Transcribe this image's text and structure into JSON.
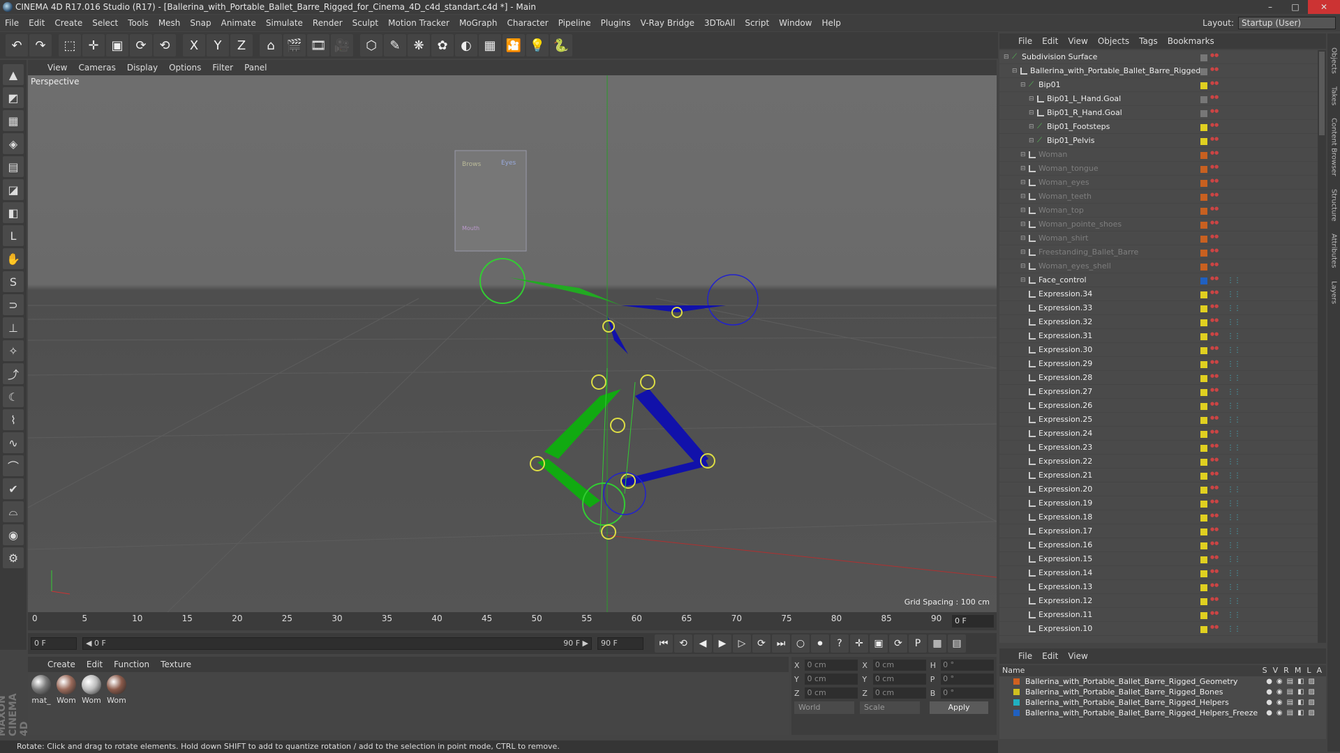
{
  "window": {
    "title": "CINEMA 4D R17.016 Studio (R17) - [Ballerina_with_Portable_Ballet_Barre_Rigged_for_Cinema_4D_c4d_standart.c4d *] - Main",
    "minimize": "–",
    "maximize": "□",
    "close": "✕"
  },
  "menu": [
    "File",
    "Edit",
    "Create",
    "Select",
    "Tools",
    "Mesh",
    "Snap",
    "Animate",
    "Simulate",
    "Render",
    "Sculpt",
    "Motion Tracker",
    "MoGraph",
    "Character",
    "Pipeline",
    "Plugins",
    "V-Ray Bridge",
    "3DToAll",
    "Script",
    "Window",
    "Help"
  ],
  "layout": {
    "label": "Layout:",
    "value": "Startup (User)"
  },
  "toolbar": {
    "icons": [
      "↶",
      "↷",
      "⬚",
      "✛",
      "▣",
      "⟳",
      "⟲",
      "X",
      "Y",
      "Z",
      "⌂",
      "🎬",
      "🎞",
      "🎥",
      "⬡",
      "✎",
      "❋",
      "✿",
      "◐",
      "▦",
      "🎦",
      "💡",
      "🐍"
    ]
  },
  "left_tools": [
    "▲",
    "◩",
    "▦",
    "◈",
    "▤",
    "◪",
    "◧",
    "L",
    "✋",
    "S",
    "⊃",
    "⊥",
    "✧",
    "⤴",
    "☾",
    "⌇",
    "∿",
    "⌒",
    "✔",
    "⌓",
    "◉",
    "⚙"
  ],
  "viewport": {
    "menu": [
      "View",
      "Cameras",
      "Display",
      "Options",
      "Filter",
      "Panel"
    ],
    "label": "Perspective",
    "grid_spacing": "Grid Spacing : 100 cm",
    "panel_labels": [
      "Brows",
      "Eyes",
      "Mouth"
    ]
  },
  "timeline": {
    "ticks": [
      "0",
      "5",
      "10",
      "15",
      "20",
      "25",
      "30",
      "35",
      "40",
      "45",
      "50",
      "55",
      "60",
      "65",
      "70",
      "75",
      "80",
      "85",
      "90"
    ],
    "current_frame": "0 F"
  },
  "transport": {
    "start_frame": "0 F",
    "range_start": "◀ 0 F",
    "range_end": "90 F ▶",
    "end_frame": "90 F",
    "buttons": [
      "⏮",
      "⟲",
      "◀",
      "▶",
      "▷",
      "⟳",
      "⏭",
      "○",
      "⏺",
      "?",
      "✛",
      "▣",
      "⟳",
      "P",
      "▦",
      "▤"
    ]
  },
  "material_manager": {
    "menu": [
      "Create",
      "Edit",
      "Function",
      "Texture"
    ],
    "materials": [
      {
        "name": "mat_",
        "color": "#7a7a7a"
      },
      {
        "name": "Wom",
        "color": "#9a6a5a"
      },
      {
        "name": "Wom",
        "color": "#bbbbbb"
      },
      {
        "name": "Wom",
        "color": "#8a5a4a"
      }
    ]
  },
  "coordinates": {
    "rows": [
      {
        "a": "X",
        "av": "0 cm",
        "b": "X",
        "bv": "0 cm",
        "c": "H",
        "cv": "0 °"
      },
      {
        "a": "Y",
        "av": "0 cm",
        "b": "Y",
        "bv": "0 cm",
        "c": "P",
        "cv": "0 °"
      },
      {
        "a": "Z",
        "av": "0 cm",
        "b": "Z",
        "bv": "0 cm",
        "c": "B",
        "cv": "0 °"
      }
    ],
    "mode": "World",
    "scale": "Scale",
    "apply": "Apply"
  },
  "status": "Rotate: Click and drag to rotate elements. Hold down SHIFT to add to quantize rotation / add to the selection in point mode, CTRL to remove.",
  "brand": "MAXON CINEMA 4D",
  "object_manager": {
    "menu": [
      "File",
      "Edit",
      "View",
      "Objects",
      "Tags",
      "Bookmarks"
    ],
    "objects": [
      {
        "name": "Subdivision Surface",
        "indent": 0,
        "icon": "bone",
        "dim": false,
        "tag": "#777777"
      },
      {
        "name": "Ballerina_with_Portable_Ballet_Barre_Rigged",
        "indent": 1,
        "icon": "null",
        "dim": false,
        "tag": "#777777"
      },
      {
        "name": "Bip01",
        "indent": 2,
        "icon": "bone",
        "dim": false,
        "tag": "#e0d020"
      },
      {
        "name": "Bip01_L_Hand.Goal",
        "indent": 3,
        "icon": "null",
        "dim": false,
        "tag": "#777777"
      },
      {
        "name": "Bip01_R_Hand.Goal",
        "indent": 3,
        "icon": "null",
        "dim": false,
        "tag": "#777777"
      },
      {
        "name": "Bip01_Footsteps",
        "indent": 3,
        "icon": "bone",
        "dim": false,
        "tag": "#e0d020"
      },
      {
        "name": "Bip01_Pelvis",
        "indent": 3,
        "icon": "bone",
        "dim": false,
        "tag": "#e0d020"
      },
      {
        "name": "Woman",
        "indent": 2,
        "icon": "null",
        "dim": true,
        "tag": "#c86020"
      },
      {
        "name": "Woman_tongue",
        "indent": 2,
        "icon": "null",
        "dim": true,
        "tag": "#c86020"
      },
      {
        "name": "Woman_eyes",
        "indent": 2,
        "icon": "null",
        "dim": true,
        "tag": "#c86020"
      },
      {
        "name": "Woman_teeth",
        "indent": 2,
        "icon": "null",
        "dim": true,
        "tag": "#c86020"
      },
      {
        "name": "Woman_top",
        "indent": 2,
        "icon": "null",
        "dim": true,
        "tag": "#c86020"
      },
      {
        "name": "Woman_pointe_shoes",
        "indent": 2,
        "icon": "null",
        "dim": true,
        "tag": "#c86020"
      },
      {
        "name": "Woman_shirt",
        "indent": 2,
        "icon": "null",
        "dim": true,
        "tag": "#c86020"
      },
      {
        "name": "Freestanding_Ballet_Barre",
        "indent": 2,
        "icon": "null",
        "dim": true,
        "tag": "#c86020"
      },
      {
        "name": "Woman_eyes_shell",
        "indent": 2,
        "icon": "null",
        "dim": true,
        "tag": "#c86020"
      },
      {
        "name": "Face_control",
        "indent": 2,
        "icon": "null",
        "dim": false,
        "tag": "#2060c0"
      },
      {
        "name": "Expression.34",
        "indent": 2,
        "icon": "null",
        "dim": false,
        "tag": "#e0d020"
      },
      {
        "name": "Expression.33",
        "indent": 2,
        "icon": "null",
        "dim": false,
        "tag": "#e0d020"
      },
      {
        "name": "Expression.32",
        "indent": 2,
        "icon": "null",
        "dim": false,
        "tag": "#e0d020"
      },
      {
        "name": "Expression.31",
        "indent": 2,
        "icon": "null",
        "dim": false,
        "tag": "#e0d020"
      },
      {
        "name": "Expression.30",
        "indent": 2,
        "icon": "null",
        "dim": false,
        "tag": "#e0d020"
      },
      {
        "name": "Expression.29",
        "indent": 2,
        "icon": "null",
        "dim": false,
        "tag": "#e0d020"
      },
      {
        "name": "Expression.28",
        "indent": 2,
        "icon": "null",
        "dim": false,
        "tag": "#e0d020"
      },
      {
        "name": "Expression.27",
        "indent": 2,
        "icon": "null",
        "dim": false,
        "tag": "#e0d020"
      },
      {
        "name": "Expression.26",
        "indent": 2,
        "icon": "null",
        "dim": false,
        "tag": "#e0d020"
      },
      {
        "name": "Expression.25",
        "indent": 2,
        "icon": "null",
        "dim": false,
        "tag": "#e0d020"
      },
      {
        "name": "Expression.24",
        "indent": 2,
        "icon": "null",
        "dim": false,
        "tag": "#e0d020"
      },
      {
        "name": "Expression.23",
        "indent": 2,
        "icon": "null",
        "dim": false,
        "tag": "#e0d020"
      },
      {
        "name": "Expression.22",
        "indent": 2,
        "icon": "null",
        "dim": false,
        "tag": "#e0d020"
      },
      {
        "name": "Expression.21",
        "indent": 2,
        "icon": "null",
        "dim": false,
        "tag": "#e0d020"
      },
      {
        "name": "Expression.20",
        "indent": 2,
        "icon": "null",
        "dim": false,
        "tag": "#e0d020"
      },
      {
        "name": "Expression.19",
        "indent": 2,
        "icon": "null",
        "dim": false,
        "tag": "#e0d020"
      },
      {
        "name": "Expression.18",
        "indent": 2,
        "icon": "null",
        "dim": false,
        "tag": "#e0d020"
      },
      {
        "name": "Expression.17",
        "indent": 2,
        "icon": "null",
        "dim": false,
        "tag": "#e0d020"
      },
      {
        "name": "Expression.16",
        "indent": 2,
        "icon": "null",
        "dim": false,
        "tag": "#e0d020"
      },
      {
        "name": "Expression.15",
        "indent": 2,
        "icon": "null",
        "dim": false,
        "tag": "#e0d020"
      },
      {
        "name": "Expression.14",
        "indent": 2,
        "icon": "null",
        "dim": false,
        "tag": "#e0d020"
      },
      {
        "name": "Expression.13",
        "indent": 2,
        "icon": "null",
        "dim": false,
        "tag": "#e0d020"
      },
      {
        "name": "Expression.12",
        "indent": 2,
        "icon": "null",
        "dim": false,
        "tag": "#e0d020"
      },
      {
        "name": "Expression.11",
        "indent": 2,
        "icon": "null",
        "dim": false,
        "tag": "#e0d020"
      },
      {
        "name": "Expression.10",
        "indent": 2,
        "icon": "null",
        "dim": false,
        "tag": "#e0d020"
      }
    ]
  },
  "right_tabs": [
    "Objects",
    "Takes",
    "Content Browser",
    "Structure",
    "Attributes",
    "Layers"
  ],
  "layer_manager": {
    "menu": [
      "File",
      "Edit",
      "View"
    ],
    "header": "Name",
    "columns": [
      "S",
      "V",
      "R",
      "M",
      "L",
      "A"
    ],
    "layers": [
      {
        "name": "Ballerina_with_Portable_Ballet_Barre_Rigged_Geometry",
        "color": "#d06020"
      },
      {
        "name": "Ballerina_with_Portable_Ballet_Barre_Rigged_Bones",
        "color": "#d0c020"
      },
      {
        "name": "Ballerina_with_Portable_Ballet_Barre_Rigged_Helpers",
        "color": "#20b0c0"
      },
      {
        "name": "Ballerina_with_Portable_Ballet_Barre_Rigged_Helpers_Freeze",
        "color": "#2060c0"
      }
    ]
  }
}
